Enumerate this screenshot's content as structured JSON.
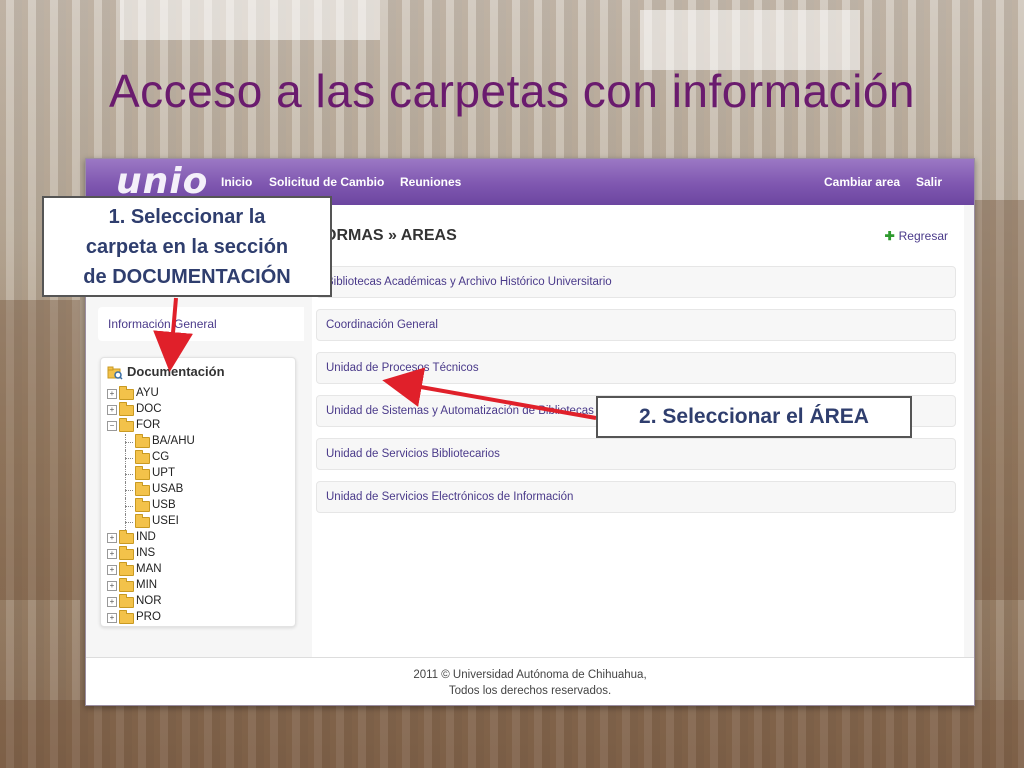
{
  "slide": {
    "title": "Acceso a las carpetas con información"
  },
  "app": {
    "logo": "unio",
    "nav": [
      "Inicio",
      "Solicitud de Cambio",
      "Reuniones"
    ],
    "nav_right": [
      "Cambiar area",
      "Salir"
    ],
    "sidebar": {
      "info_tab": "Información General",
      "doc_title": "Documentación",
      "tree": [
        {
          "label": "AYU",
          "level": 0,
          "expander": "+"
        },
        {
          "label": "DOC",
          "level": 0,
          "expander": "+"
        },
        {
          "label": "FOR",
          "level": 0,
          "expander": "-"
        },
        {
          "label": "BA/AHU",
          "level": 1
        },
        {
          "label": "CG",
          "level": 1
        },
        {
          "label": "UPT",
          "level": 1
        },
        {
          "label": "USAB",
          "level": 1
        },
        {
          "label": "USB",
          "level": 1
        },
        {
          "label": "USEI",
          "level": 1
        },
        {
          "label": "IND",
          "level": 0,
          "expander": "+"
        },
        {
          "label": "INS",
          "level": 0,
          "expander": "+"
        },
        {
          "label": "MAN",
          "level": 0,
          "expander": "+"
        },
        {
          "label": "MIN",
          "level": 0,
          "expander": "+"
        },
        {
          "label": "NOR",
          "level": 0,
          "expander": "+"
        },
        {
          "label": "PRO",
          "level": 0,
          "expander": "+"
        }
      ]
    },
    "main": {
      "breadcrumb": "ORMAS » AREAS",
      "back_label": "Regresar",
      "areas": [
        "Bibliotecas Académicas y Archivo Histórico Universitario",
        "Coordinación General",
        "Unidad de Procesos Técnicos",
        "Unidad de Sistemas y Automatización de Bibliotecas",
        "Unidad de Servicios Bibliotecarios",
        "Unidad de Servicios Electrónicos de Información"
      ]
    },
    "footer": [
      "2011 © Universidad Autónoma de Chihuahua,",
      "Todos los derechos reservados."
    ]
  },
  "callouts": {
    "step1": [
      "1. Seleccionar la",
      "carpeta en la sección",
      "de DOCUMENTACIÓN"
    ],
    "step2": "2. Seleccionar el ÁREA"
  },
  "colors": {
    "title": "#6a1b6e",
    "topbar": "#7f57b0",
    "link": "#4a3a8a",
    "arrow": "#e0202a"
  }
}
